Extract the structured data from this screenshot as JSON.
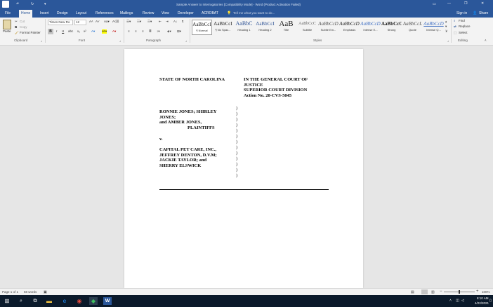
{
  "window": {
    "title": "Sample Answer to Interrogatories [Compatibility Mode] - Word (Product Activation Failed)",
    "sign_in": "Sign in",
    "minimize_glyph": "—",
    "restore_glyph": "❐",
    "close_glyph": "✕"
  },
  "tabs": [
    "File",
    "Home",
    "Insert",
    "Design",
    "Layout",
    "References",
    "Mailings",
    "Review",
    "View",
    "Developer",
    "ACROBAT"
  ],
  "active_tab": "Home",
  "tell_me": "Tell me what you want to do...",
  "share": "Share",
  "clipboard": {
    "paste": "Paste",
    "cut": "Cut",
    "copy": "Copy",
    "format_painter": "Format Painter",
    "label": "Clipboard"
  },
  "font": {
    "name": "Times New Ro",
    "size": "12",
    "label": "Font",
    "bold": "B",
    "italic": "I",
    "underline": "U"
  },
  "paragraph": {
    "label": "Paragraph"
  },
  "styles": {
    "label": "Styles",
    "items": [
      {
        "preview": "AaBbCcI",
        "name": "¶ Normal"
      },
      {
        "preview": "AaBbCcI",
        "name": "¶ No Spac..."
      },
      {
        "preview": "AaBbC",
        "name": "Heading 1"
      },
      {
        "preview": "AaBbCcI",
        "name": "Heading 2"
      },
      {
        "preview": "AaB",
        "name": "Title"
      },
      {
        "preview": "AaBbCcC",
        "name": "Subtitle"
      },
      {
        "preview": "AaBbCcD",
        "name": "Subtle Em..."
      },
      {
        "preview": "AaBbCcD",
        "name": "Emphasis"
      },
      {
        "preview": "AaBbCcD",
        "name": "Intense E..."
      },
      {
        "preview": "AaBbCcC",
        "name": "Strong"
      },
      {
        "preview": "AaBbCcL",
        "name": "Quote"
      },
      {
        "preview": "AaBbCcD",
        "name": "Intense Q..."
      }
    ]
  },
  "editing": {
    "find": "Find",
    "replace": "Replace",
    "select": "Select",
    "label": "Editing"
  },
  "document": {
    "left_header": "STATE OF NORTH CAROLINA",
    "right_header": [
      "IN THE GENERAL COURT OF",
      "JUSTICE",
      "SUPERIOR COURT DIVISION",
      "Action No. 20-CVS-5045"
    ],
    "plaintiffs": [
      "RONNIE JONES; SHIRLEY",
      "JONES;",
      "and AMBER JONES,"
    ],
    "plaintiffs_label": "PLAINTIFFS",
    "versus": "v.",
    "defendants": [
      "CAPITAL PET CARE, INC.,",
      "JEFFREY DENTON, D.V.M;",
      "JACKIE TAYLOR; and",
      "SHERRY ELSWICK"
    ],
    "paren": ")"
  },
  "status": {
    "page": "Page 1 of 1",
    "words": "58 words",
    "zoom": "100%"
  },
  "clock": {
    "time": "8:10 AM",
    "date": "4/22/2021"
  },
  "colors": {
    "word_blue": "#2b579a",
    "taskbar": "#0b1a2b",
    "ribbon": "#f3f3f3"
  }
}
